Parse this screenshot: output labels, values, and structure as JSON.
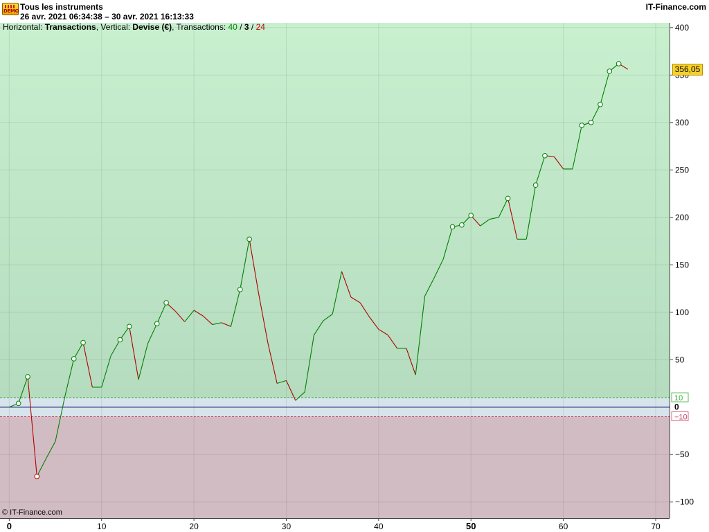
{
  "header": {
    "logo_icon": "demo-badge-icon",
    "logo_text": "DEMO",
    "title": "Tous les instruments",
    "date_range": "26 avr. 2021 06:34:38 – 30 avr. 2021 16:13:33",
    "brand": "IT-Finance.com"
  },
  "legend": {
    "h_label": "Horizontal: ",
    "h_value": "Transactions",
    "v_label": ", Vertical: ",
    "v_value": "Devise (€)",
    "t_label": ", Transactions: ",
    "wins": "40",
    "sep1": " / ",
    "neutral": "3",
    "sep2": " / ",
    "losses": "24"
  },
  "footer": {
    "copyright": "© IT-Finance.com"
  },
  "last_value_label": "356,05",
  "colors": {
    "profit_zone_top": "#c8f0cf",
    "profit_zone_bottom": "#b5dcbf",
    "loss_zone": "#d2bcc3",
    "neutral_zone": "#d8e4ec",
    "up_line": "#008000",
    "down_line": "#b00000",
    "zero_line": "#1f2f7a",
    "threshold_up": "#33aa33",
    "threshold_down": "#cc4466",
    "marker_label": "#f7d12a"
  },
  "chart_data": {
    "type": "line",
    "x": [
      0,
      1,
      2,
      3,
      4,
      5,
      6,
      7,
      8,
      9,
      10,
      11,
      12,
      13,
      14,
      15,
      16,
      17,
      18,
      19,
      20,
      21,
      22,
      23,
      24,
      25,
      26,
      27,
      28,
      29,
      30,
      31,
      32,
      33,
      34,
      35,
      36,
      37,
      38,
      39,
      40,
      41,
      42,
      43,
      44,
      45,
      46,
      47,
      48,
      49,
      50,
      51,
      52,
      53,
      54,
      55,
      56,
      57,
      58,
      59,
      60,
      61,
      62,
      63,
      64,
      65,
      66,
      67
    ],
    "y": [
      0,
      4,
      32,
      -73,
      -54,
      -36,
      10,
      51,
      68,
      21,
      21,
      54,
      71,
      85,
      29,
      67,
      88,
      110,
      101,
      90,
      102,
      96,
      87,
      89,
      85,
      124,
      177,
      120,
      68,
      25,
      28,
      7,
      16,
      76,
      91,
      98,
      143,
      116,
      110,
      95,
      82,
      76,
      62,
      62,
      34,
      117,
      136,
      156,
      190,
      192,
      202,
      191,
      198,
      200,
      220,
      177,
      177,
      234,
      265,
      264,
      251,
      251,
      297,
      300,
      319,
      354,
      362,
      356.05
    ],
    "markers": [
      1,
      2,
      3,
      7,
      8,
      12,
      13,
      16,
      17,
      25,
      26,
      48,
      49,
      50,
      54,
      57,
      58,
      62,
      63,
      64,
      65,
      66
    ],
    "xlim": [
      -1,
      71.5
    ],
    "ylim": [
      -117,
      405
    ],
    "x_ticks": [
      {
        "v": 0,
        "label": "0",
        "bold": true
      },
      {
        "v": 10,
        "label": "10",
        "bold": false
      },
      {
        "v": 20,
        "label": "20",
        "bold": false
      },
      {
        "v": 30,
        "label": "30",
        "bold": false
      },
      {
        "v": 40,
        "label": "40",
        "bold": false
      },
      {
        "v": 50,
        "label": "50",
        "bold": true
      },
      {
        "v": 60,
        "label": "60",
        "bold": false
      },
      {
        "v": 70,
        "label": "70",
        "bold": false
      }
    ],
    "y_ticks": [
      {
        "v": 400,
        "label": "400"
      },
      {
        "v": 350,
        "label": "350"
      },
      {
        "v": 300,
        "label": "300"
      },
      {
        "v": 250,
        "label": "250"
      },
      {
        "v": 200,
        "label": "200"
      },
      {
        "v": 150,
        "label": "150"
      },
      {
        "v": 100,
        "label": "100"
      },
      {
        "v": 50,
        "label": "50"
      },
      {
        "v": -50,
        "label": "−50"
      },
      {
        "v": -100,
        "label": "−100"
      }
    ],
    "zero_label": "0",
    "threshold_upper": {
      "v": 10,
      "label": "10"
    },
    "threshold_lower": {
      "v": -10,
      "label": "−10"
    },
    "grid": true
  }
}
